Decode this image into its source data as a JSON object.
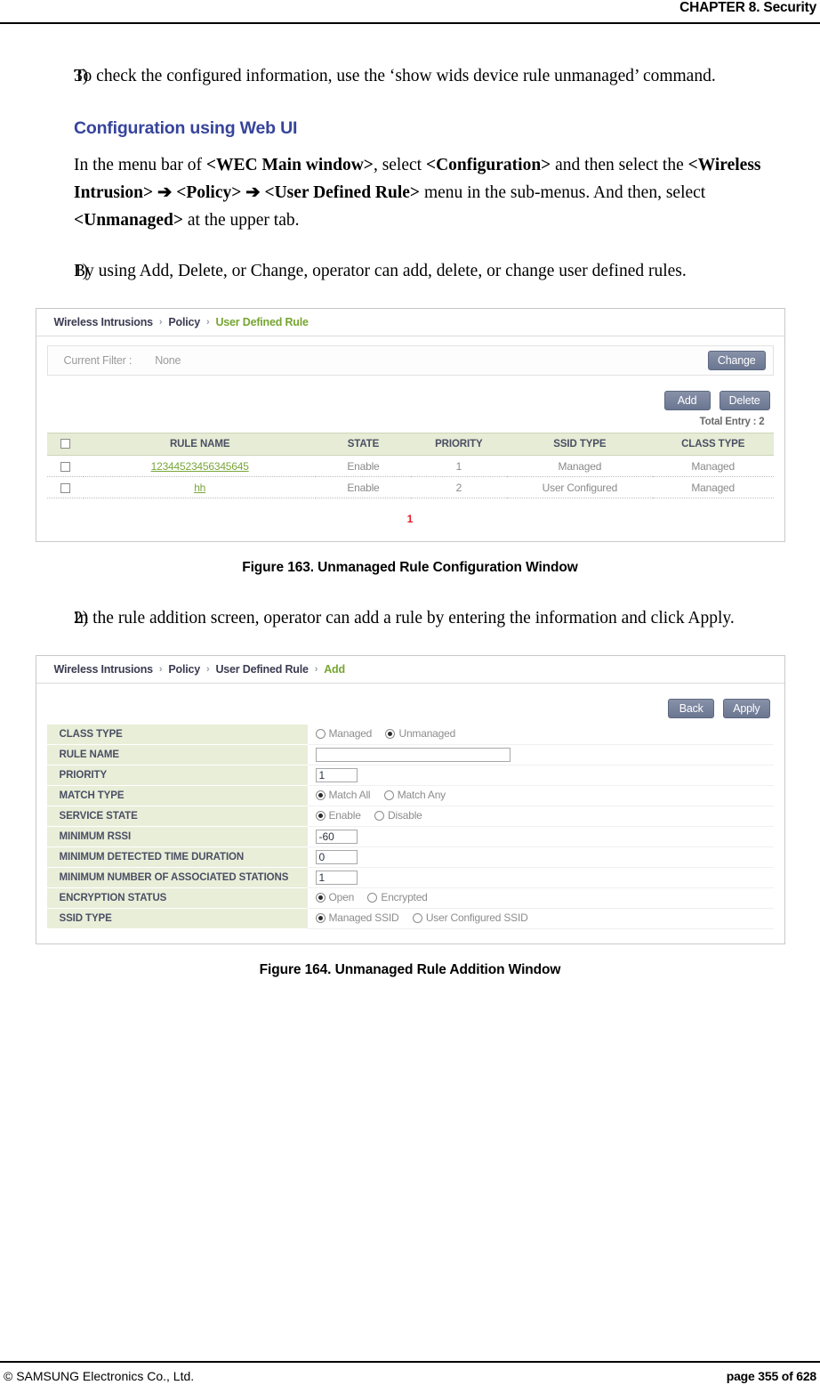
{
  "header": {
    "chapter": "CHAPTER 8. Security"
  },
  "body": {
    "item3": {
      "number": "3)",
      "text": "To check the configured information, use the ‘show wids device rule unmanaged’ command."
    },
    "section_title": "Configuration using Web UI",
    "intro_paragraph": {
      "part1": "In the menu bar of ",
      "bold1": "<WEC Main window>",
      "part2": ", select ",
      "bold2": "<Configuration>",
      "part3": " and then select the ",
      "bold3": "<Wireless Intrusion>",
      "arrow1": " ➔ ",
      "bold4": "<Policy>",
      "arrow2": " ➔ ",
      "bold5": "<User Defined Rule>",
      "part4": " menu in the sub-menus. And then, select ",
      "bold6": "<Unmanaged>",
      "part5": " at the upper tab."
    },
    "item1": {
      "number": "1)",
      "text": "By using Add, Delete, or Change, operator can add, delete, or change user defined rules."
    },
    "item2": {
      "number": "2)",
      "text": "In the rule addition screen, operator can add a rule by entering the information and click Apply."
    }
  },
  "figure163": {
    "caption": "Figure 163. Unmanaged Rule Configuration Window",
    "breadcrumb": {
      "item1": "Wireless Intrusions",
      "item2": "Policy",
      "item3": "User Defined Rule",
      "separator": "›"
    },
    "filter": {
      "label": "Current Filter :",
      "value": "None",
      "change_button": "Change"
    },
    "actions": {
      "add_button": "Add",
      "delete_button": "Delete"
    },
    "total_entry": "Total Entry : 2",
    "table": {
      "columns": [
        "RULE NAME",
        "STATE",
        "PRIORITY",
        "SSID TYPE",
        "CLASS TYPE"
      ],
      "rows": [
        {
          "rule_name": "12344523456345645",
          "state": "Enable",
          "priority": "1",
          "ssid_type": "Managed",
          "class_type": "Managed"
        },
        {
          "rule_name": "hh",
          "state": "Enable",
          "priority": "2",
          "ssid_type": "User Configured",
          "class_type": "Managed"
        }
      ]
    },
    "pagination": {
      "current_page": "1"
    }
  },
  "figure164": {
    "caption": "Figure 164. Unmanaged Rule Addition Window",
    "breadcrumb": {
      "item1": "Wireless Intrusions",
      "item2": "Policy",
      "item3": "User Defined Rule",
      "item4": "Add",
      "separator": "›"
    },
    "actions": {
      "back_button": "Back",
      "apply_button": "Apply"
    },
    "form": {
      "class_type": {
        "label": "CLASS TYPE",
        "option1": "Managed",
        "option2": "Unmanaged",
        "selected": "Unmanaged"
      },
      "rule_name": {
        "label": "RULE NAME",
        "value": ""
      },
      "priority": {
        "label": "PRIORITY",
        "value": "1"
      },
      "match_type": {
        "label": "MATCH TYPE",
        "option1": "Match All",
        "option2": "Match Any",
        "selected": "Match All"
      },
      "service_state": {
        "label": "SERVICE STATE",
        "option1": "Enable",
        "option2": "Disable",
        "selected": "Enable"
      },
      "minimum_rssi": {
        "label": "MINIMUM RSSI",
        "value": "-60"
      },
      "minimum_detected_time": {
        "label": "MINIMUM DETECTED TIME DURATION",
        "value": "0"
      },
      "minimum_stations": {
        "label": "MINIMUM NUMBER OF ASSOCIATED STATIONS",
        "value": "1"
      },
      "encryption_status": {
        "label": "ENCRYPTION STATUS",
        "option1": "Open",
        "option2": "Encrypted",
        "selected": "Open"
      },
      "ssid_type": {
        "label": "SSID TYPE",
        "option1": "Managed SSID",
        "option2": "User Configured SSID",
        "selected": "Managed SSID"
      }
    }
  },
  "footer": {
    "copyright": "© SAMSUNG Electronics Co., Ltd.",
    "page": "page 355 of 628"
  },
  "colors": {
    "section_title": "#36449b",
    "breadcrumb_active": "#76a531",
    "button": "#6b7691",
    "table_header": "#e6ecd5",
    "link": "#7aa63a",
    "pagination": "#e8192c"
  }
}
